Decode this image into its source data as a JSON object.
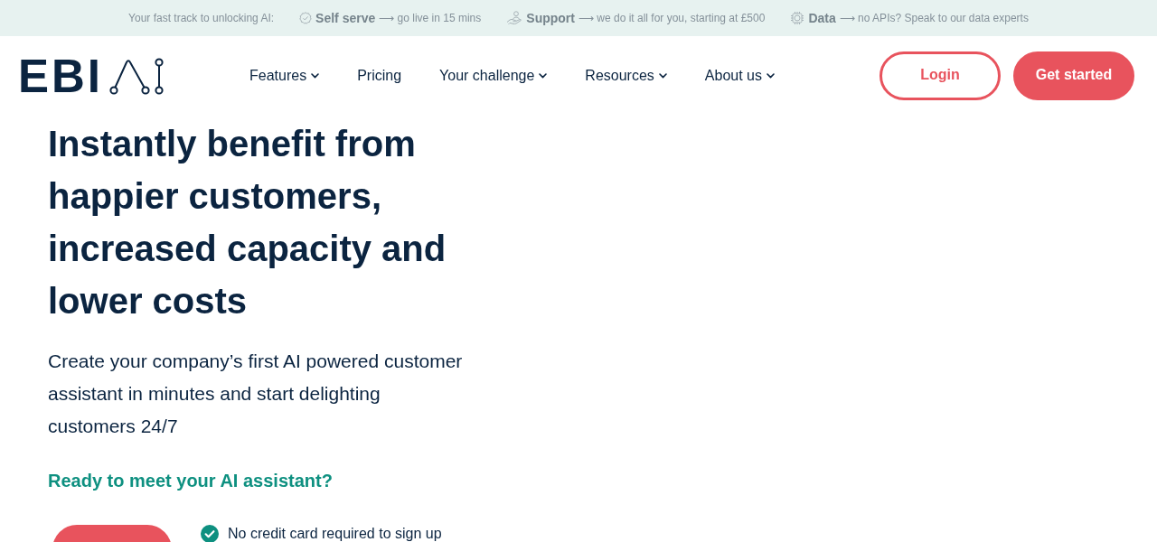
{
  "promo_bar": {
    "intro": "Your fast track to unlocking AI:",
    "items": [
      {
        "title": "Self serve",
        "description": "⟶ go live in 15 mins"
      },
      {
        "title": "Support",
        "description": "⟶ we do it all for you, starting at £500"
      },
      {
        "title": "Data",
        "description": "⟶ no APIs? Speak to our data experts"
      }
    ]
  },
  "header": {
    "logo": "EBI",
    "nav": [
      {
        "label": "Features",
        "dropdown": true
      },
      {
        "label": "Pricing",
        "dropdown": false
      },
      {
        "label": "Your challenge",
        "dropdown": true
      },
      {
        "label": "Resources",
        "dropdown": true
      },
      {
        "label": "About us",
        "dropdown": true
      }
    ],
    "buttons": [
      {
        "label": "Login",
        "kind": "outline"
      },
      {
        "label": "Get started",
        "kind": "filled"
      }
    ]
  },
  "hero": {
    "headline": "Instantly benefit from happier customers, increased capacity and lower costs",
    "subtitle": "Create your company’s first AI powered customer assistant in minutes and start delighting customers 24/7",
    "cta_heading": "Ready to meet your AI assistant?",
    "benefits": [
      "No credit card required to sign up"
    ]
  }
}
